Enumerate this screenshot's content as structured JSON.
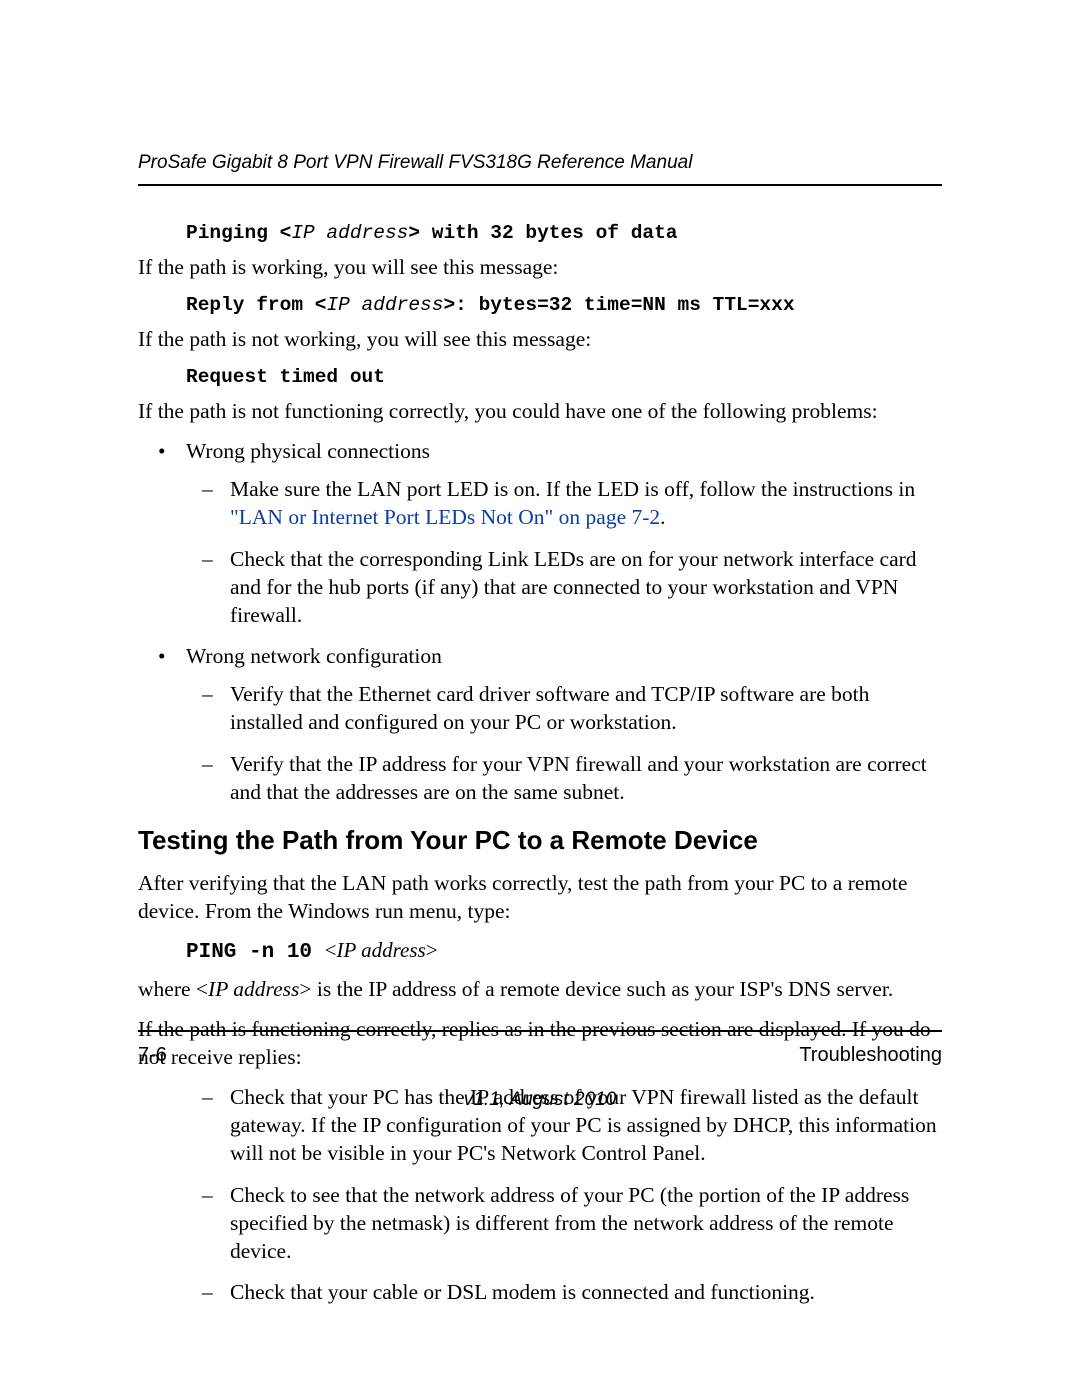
{
  "header": {
    "title": "ProSafe Gigabit 8 Port VPN Firewall FVS318G Reference Manual"
  },
  "code": {
    "pinging_prefix": "Pinging <",
    "ip_addr": "IP address",
    "pinging_suffix": "> with 32 bytes of data",
    "reply_prefix": "Reply from <",
    "reply_suffix": ">: bytes=32 time=NN ms TTL=xxx",
    "request_timed_out": "Request timed out"
  },
  "paragraphs": {
    "path_working": "If the path is working, you will see this message:",
    "path_not_working": "If the path is not working, you will see this message:",
    "not_functioning": "If the path is not functioning correctly, you could have one of the following problems:",
    "after_verify": "After verifying that the LAN path works correctly, test the path from your PC to a remote device. From the Windows run menu, type:",
    "where_prefix": "where <",
    "where_ip": "IP address",
    "where_suffix": "> is the IP address of a remote device such as your ISP's DNS server.",
    "if_func": "If the path is functioning correctly, replies as in the previous section are displayed. If you do not receive replies:"
  },
  "bullets1": {
    "b1": "Wrong physical connections",
    "b1_d1_pre": "Make sure the LAN port LED is on. If the LED is off, follow the instructions in ",
    "b1_d1_link": "\"LAN or Internet Port LEDs Not On\" on page 7-2",
    "b1_d1_post": ".",
    "b1_d2": "Check that the corresponding Link LEDs are on for your network interface card and for the hub ports (if any) that are connected to your workstation and VPN firewall.",
    "b2": "Wrong network configuration",
    "b2_d1": "Verify that the Ethernet card driver software and TCP/IP software are both installed and configured on your PC or workstation.",
    "b2_d2": "Verify that the IP address for your VPN firewall and your workstation are correct and that the addresses are on the same subnet."
  },
  "heading2": "Testing the Path from Your PC to a Remote Device",
  "cmd": {
    "bold": "PING -n 10 ",
    "arg_open": "<",
    "arg_ip": "IP address",
    "arg_close": ">"
  },
  "dashes2": {
    "d1": "Check that your PC has the IP address of your VPN firewall listed as the default gateway. If the IP configuration of your PC is assigned by DHCP, this information will not be visible in your PC's Network Control Panel.",
    "d2": "Check to see that the network address of your PC (the portion of the IP address specified by the netmask) is different from the network address of the remote device.",
    "d3": "Check that your cable or DSL modem is connected and functioning."
  },
  "footer": {
    "page": "7-6",
    "section": "Troubleshooting",
    "version": "v1.1, August 2010"
  }
}
